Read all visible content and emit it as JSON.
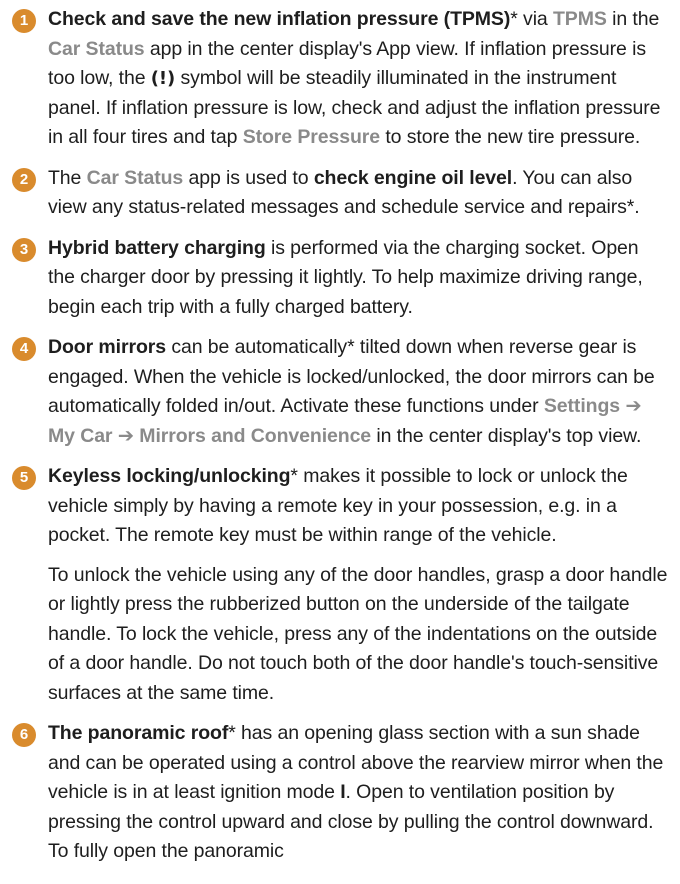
{
  "items": [
    {
      "number": "1",
      "p1": {
        "s0": "Check and save the new inflation pressure (TPMS)",
        "s1": "* via ",
        "s2": "TPMS",
        "s3": " in the ",
        "s4": "Car Status",
        "s5": " app in the center display's App view. If inflation pressure is too low, the ",
        "s6": "(!)",
        "s7": " symbol will be steadily illuminated in the instrument panel. If inflation pressure is low, check and adjust the inflation pressure in all four tires and tap ",
        "s8": "Store Pressure",
        "s9": " to store the new tire pressure."
      }
    },
    {
      "number": "2",
      "p1": {
        "s0": "The ",
        "s1": "Car Status",
        "s2": " app is used to ",
        "s3": "check engine oil level",
        "s4": ". You can also view any status-related messages and schedule service and repairs*."
      }
    },
    {
      "number": "3",
      "p1": {
        "s0": "Hybrid battery charging",
        "s1": " is performed via the charging socket. Open the charger door by pressing it lightly. To help maximize driving range, begin each trip with a fully charged battery."
      }
    },
    {
      "number": "4",
      "p1": {
        "s0": "Door mirrors",
        "s1": " can be automatically* tilted down when reverse gear is engaged. When the vehicle is locked/unlocked, the door mirrors can be automatically folded in/out. Activate these functions under ",
        "s2": "Settings ➔ My Car ➔ Mirrors and Convenience",
        "s3": " in the center display's top view."
      }
    },
    {
      "number": "5",
      "p1": {
        "s0": "Keyless locking/unlocking",
        "s1": "* makes it possible to lock or unlock the vehicle simply by having a remote key in your possession, e.g. in a pocket. The remote key must be within range of the vehicle."
      },
      "p2": "To unlock the vehicle using any of the door handles, grasp a door handle or lightly press the rubberized button on the underside of the tailgate handle. To lock the vehicle, press any of the indentations on the outside of a door handle. Do not touch both of the door handle's touch-sensitive surfaces at the same time."
    },
    {
      "number": "6",
      "p1": {
        "s0": "The panoramic roof",
        "s1": "* has an opening glass section with a sun shade and can be operated using a control above the rearview mirror when the vehicle is in at least ignition mode ",
        "s2": "I",
        "s3": ". Open to ventilation position by pressing the control upward and close by pulling the control downward. To fully open the panoramic"
      }
    }
  ]
}
